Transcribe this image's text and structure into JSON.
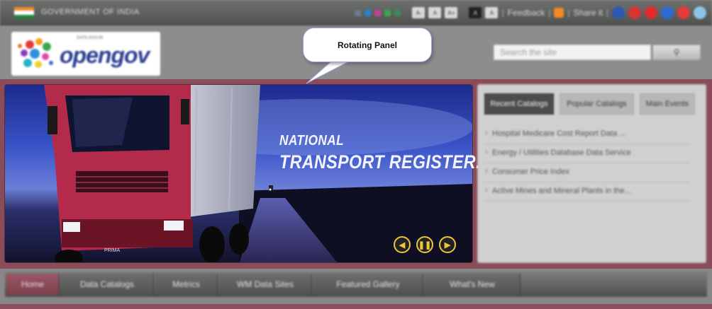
{
  "topbar": {
    "government_text": "GOVERNMENT OF INDIA",
    "swatches": [
      "#6d7b8e",
      "#2e7fd8",
      "#c0449a",
      "#38a84a",
      "#3a8a5c"
    ],
    "font_buttons": [
      "A-",
      "A",
      "A+"
    ],
    "contrast_buttons": [
      "A",
      "A"
    ],
    "feedback_label": "Feedback",
    "share_label": "Share it",
    "language_flags": [
      "#2f58b3",
      "#d83434",
      "#e22a2a",
      "#2d6bd1",
      "#e43b3b",
      "#8ec3e8"
    ]
  },
  "header": {
    "logo_text": "opengov",
    "logo_tagline": "DATA.GOV.IN",
    "search_placeholder": "Search the site",
    "search_button_icon": "search-icon"
  },
  "callout": {
    "label": "Rotating Panel"
  },
  "slider": {
    "headline_line1": "NATIONAL",
    "headline_line2": "TRANSPORT REGISTER...",
    "prev_icon": "chevron-left-icon",
    "pause_icon": "pause-icon",
    "next_icon": "chevron-right-icon",
    "truck_brand": "PRIMA"
  },
  "side_panel": {
    "tabs": [
      {
        "label": "Recent Catalogs",
        "active": true
      },
      {
        "label": "Popular Catalogs",
        "active": false
      },
      {
        "label": "Main Events",
        "active": false
      }
    ],
    "items": [
      "Hospital Medicare Cost Report Data ...",
      "Energy / Utilities Database Data Service",
      "Consumer Price Index",
      "Active Mines and Mineral Plants in the..."
    ]
  },
  "nav": {
    "items": [
      {
        "label": "Home",
        "active": true
      },
      {
        "label": "Data Catalogs",
        "active": false
      },
      {
        "label": "Metrics",
        "active": false
      },
      {
        "label": "WM Data Sites",
        "active": false
      },
      {
        "label": "Featured Gallery",
        "active": false
      },
      {
        "label": "What's New",
        "active": false
      }
    ]
  }
}
